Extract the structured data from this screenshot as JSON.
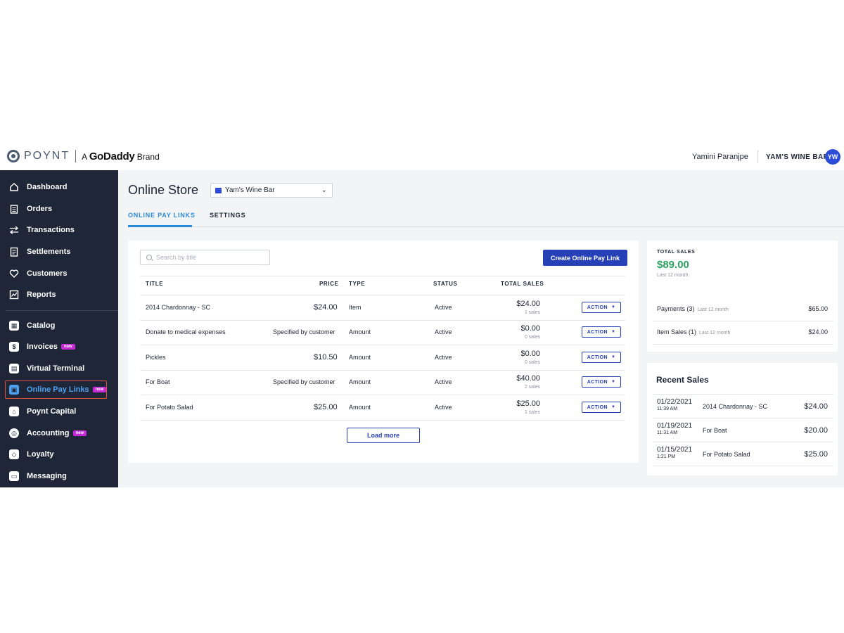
{
  "header": {
    "logo_text": "POYNT",
    "brand_prefix": "A",
    "brand_name": "GoDaddy",
    "brand_suffix": "Brand",
    "user_name": "Yamini Paranjpe",
    "store_name": "YAM'S WINE BAR",
    "avatar_initials": "YW"
  },
  "sidebar": {
    "items": [
      {
        "label": "Dashboard",
        "icon": "home-icon"
      },
      {
        "label": "Orders",
        "icon": "clipboard-icon"
      },
      {
        "label": "Transactions",
        "icon": "arrows-icon"
      },
      {
        "label": "Settlements",
        "icon": "document-icon"
      },
      {
        "label": "Customers",
        "icon": "heart-icon"
      },
      {
        "label": "Reports",
        "icon": "chart-icon"
      },
      {
        "label": "Catalog",
        "icon": "grid-icon"
      },
      {
        "label": "Invoices",
        "icon": "invoice-icon",
        "badge": "new"
      },
      {
        "label": "Virtual Terminal",
        "icon": "terminal-icon"
      },
      {
        "label": "Online Pay Links",
        "icon": "paylink-icon",
        "badge": "new",
        "active": true
      },
      {
        "label": "Poynt Capital",
        "icon": "bank-icon"
      },
      {
        "label": "Accounting",
        "icon": "accounting-icon",
        "badge": "new"
      },
      {
        "label": "Loyalty",
        "icon": "tag-icon"
      },
      {
        "label": "Messaging",
        "icon": "message-icon"
      }
    ]
  },
  "main": {
    "title": "Online Store",
    "store_select": "Yam's Wine Bar",
    "tabs": [
      {
        "label": "ONLINE PAY LINKS",
        "active": true
      },
      {
        "label": "SETTINGS",
        "active": false
      }
    ],
    "search_placeholder": "Search by title",
    "create_button": "Create Online Pay Link",
    "columns": [
      "TITLE",
      "PRICE",
      "TYPE",
      "STATUS",
      "TOTAL SALES"
    ],
    "rows": [
      {
        "title": "2014 Chardonnay - SC",
        "price": "$24.00",
        "type": "Item",
        "status": "Active",
        "total": "$24.00",
        "sales": "1 sales",
        "action": "ACTION"
      },
      {
        "title": "Donate to medical expenses",
        "price": "Specified by customer",
        "type": "Amount",
        "status": "Active",
        "total": "$0.00",
        "sales": "0 sales",
        "action": "ACTION"
      },
      {
        "title": "Pickles",
        "price": "$10.50",
        "type": "Amount",
        "status": "Active",
        "total": "$0.00",
        "sales": "0 sales",
        "action": "ACTION"
      },
      {
        "title": "For Boat",
        "price": "Specified by customer",
        "type": "Amount",
        "status": "Active",
        "total": "$40.00",
        "sales": "2 sales",
        "action": "ACTION"
      },
      {
        "title": "For Potato Salad",
        "price": "$25.00",
        "type": "Amount",
        "status": "Active",
        "total": "$25.00",
        "sales": "1 sales",
        "action": "ACTION"
      }
    ],
    "load_more": "Load more"
  },
  "total_sales": {
    "label": "TOTAL SALES",
    "amount": "$89.00",
    "period": "Last 12 month",
    "amount_color": "#2aa060",
    "breakdown": [
      {
        "label": "Payments (3)",
        "period": "Last 12 month",
        "amount": "$65.00"
      },
      {
        "label": "Item Sales (1)",
        "period": "Last 12 month",
        "amount": "$24.00"
      }
    ]
  },
  "recent_sales": {
    "title": "Recent Sales",
    "items": [
      {
        "date": "01/22/2021",
        "time": "11:39 AM",
        "name": "2014 Chardonnay - SC",
        "amount": "$24.00"
      },
      {
        "date": "01/19/2021",
        "time": "11:31 AM",
        "name": "For Boat",
        "amount": "$20.00"
      },
      {
        "date": "01/15/2021",
        "time": "1:21 PM",
        "name": "For Potato Salad",
        "amount": "$25.00"
      }
    ]
  },
  "colors": {
    "sidebar_bg": "#1f2637",
    "primary": "#2740b8",
    "active_link": "#2d8ad8",
    "badge": "#c82ad8"
  }
}
